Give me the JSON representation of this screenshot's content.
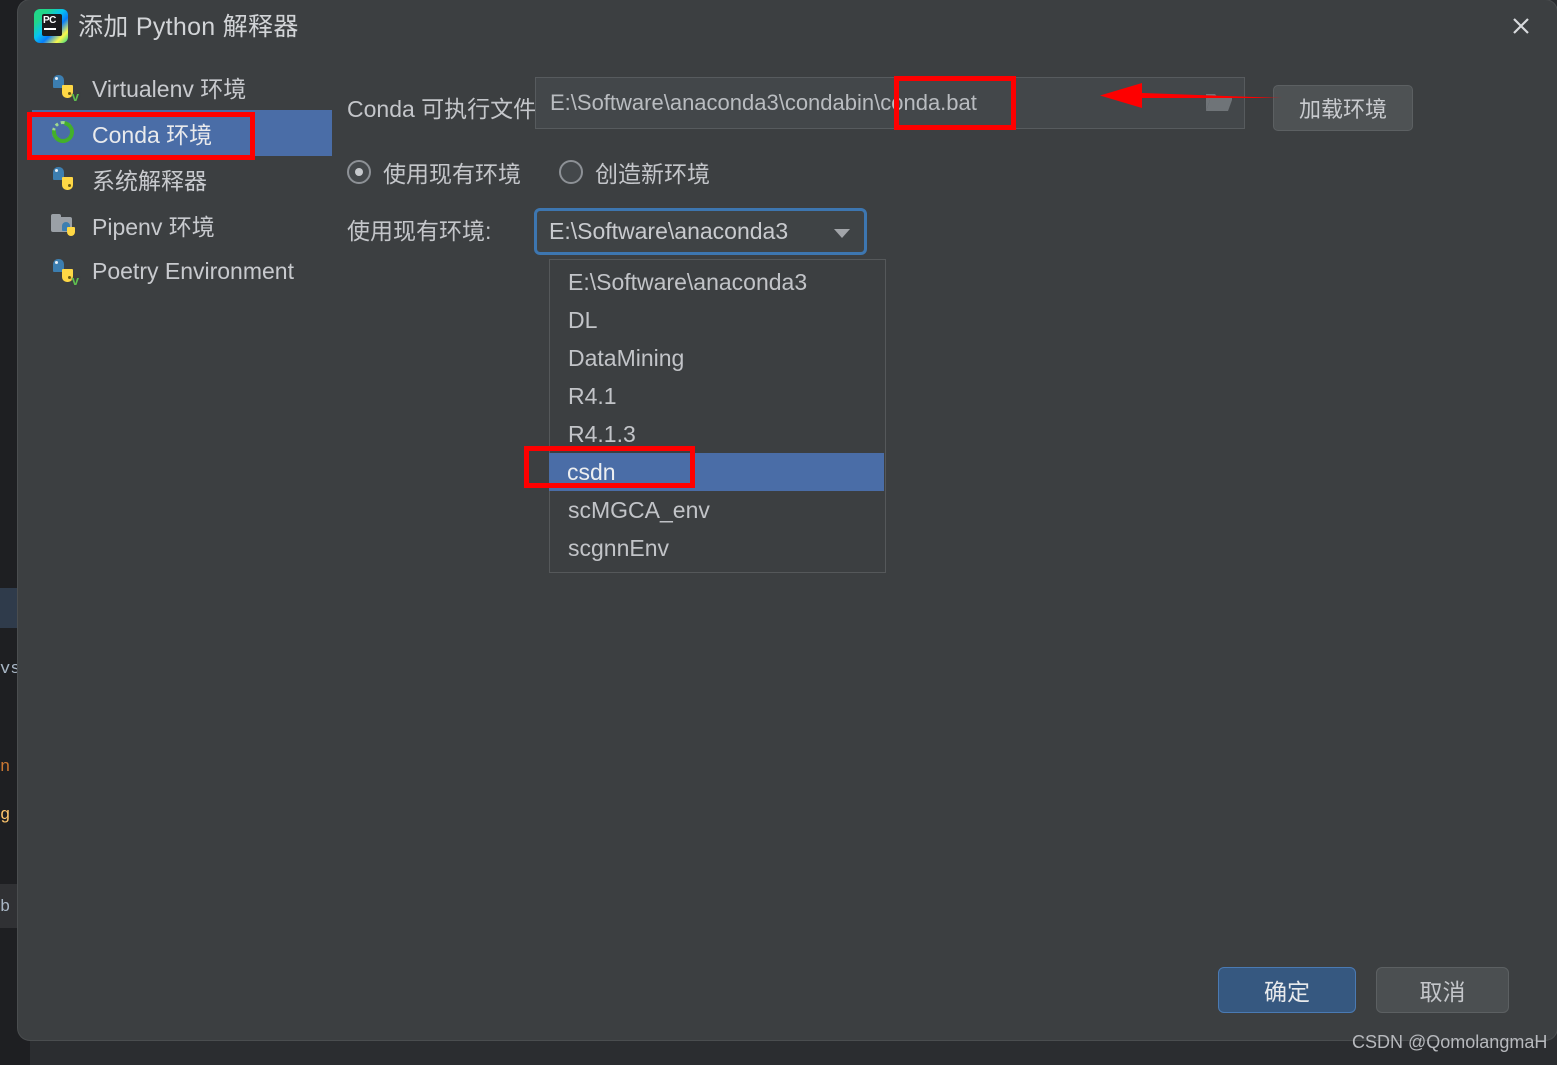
{
  "window": {
    "title": "添加 Python 解释器",
    "app_icon": "pycharm-icon",
    "close_icon": "close-icon"
  },
  "sidebar": {
    "items": [
      {
        "label": "Virtualenv 环境",
        "icon": "python-venv-icon",
        "selected": false
      },
      {
        "label": "Conda 环境",
        "icon": "conda-icon",
        "selected": true
      },
      {
        "label": "系统解释器",
        "icon": "python-icon",
        "selected": false
      },
      {
        "label": "Pipenv 环境",
        "icon": "folder-python-icon",
        "selected": false
      },
      {
        "label": "Poetry Environment",
        "icon": "python-venv-icon",
        "selected": false
      }
    ]
  },
  "main": {
    "conda_executable": {
      "label": "Conda 可执行文件:",
      "value": "E:\\Software\\anaconda3\\condabin\\conda.bat",
      "browse_icon": "folder-open-icon"
    },
    "load_env_button": "加载环境",
    "radios": [
      {
        "label": "使用现有环境",
        "checked": true
      },
      {
        "label": "创造新环境",
        "checked": false
      }
    ],
    "existing_env": {
      "label": "使用现有环境:",
      "selected": "E:\\Software\\anaconda3",
      "caret_icon": "chevron-down-icon",
      "options": [
        "E:\\Software\\anaconda3",
        "DL",
        "DataMining",
        "R4.1",
        "R4.1.3",
        "csdn",
        "scMGCA_env",
        "scgnnEnv"
      ],
      "highlighted_option": "csdn"
    }
  },
  "footer": {
    "ok_label": "确定",
    "cancel_label": "取消",
    "watermark": "CSDN @QomolangmaH"
  },
  "annotations": {
    "accent_color": "#fe0000",
    "boxes": [
      "conda-sidebar-item",
      "conda-bat-filename",
      "csdn-option"
    ],
    "arrow": "points-left-to-conda-executable-field"
  },
  "colors": {
    "dialog_bg": "#3c3f41",
    "selection_blue": "#4a6da7",
    "focus_border": "#3d76b0",
    "ok_button": "#365880",
    "annotation_red": "#fe0000"
  },
  "background_editor": {
    "fragments": [
      "vs",
      "n",
      "g",
      "b"
    ]
  }
}
